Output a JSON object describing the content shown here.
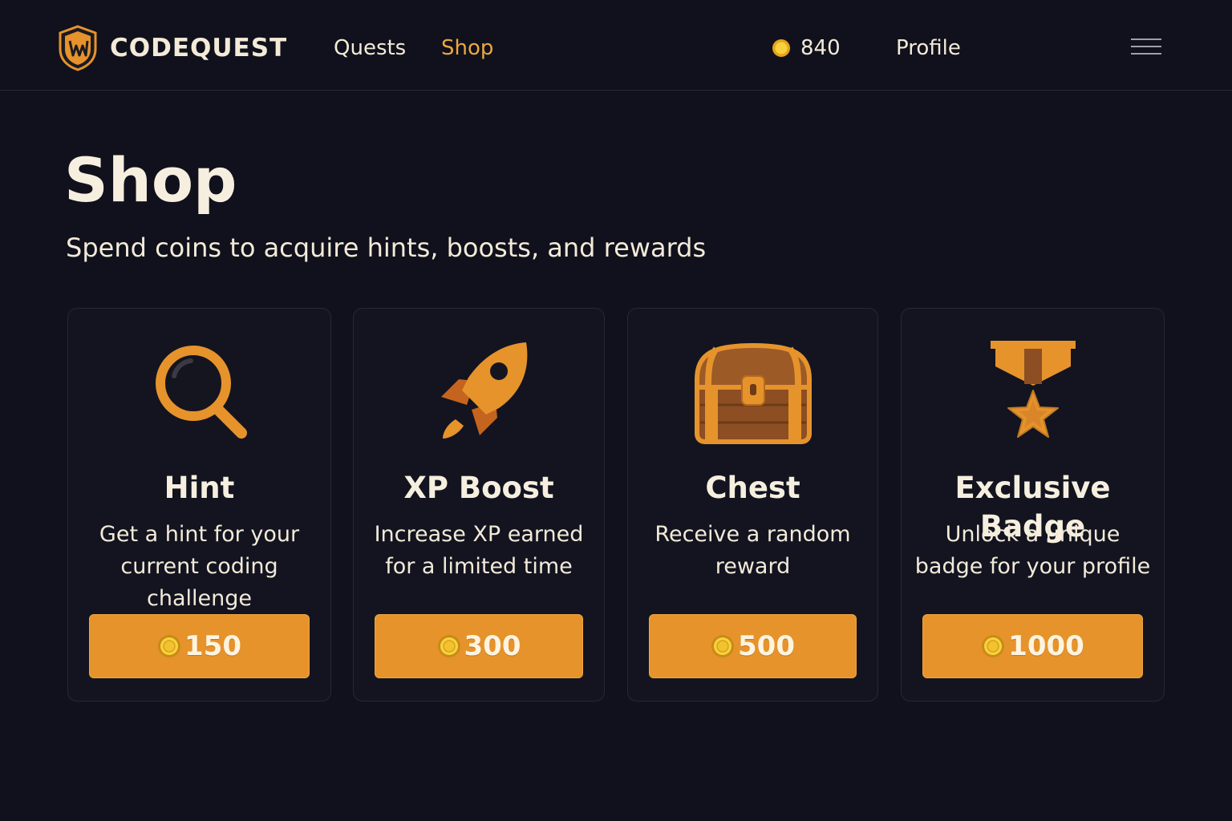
{
  "app": {
    "brand": "CODEQUEST",
    "nav": {
      "quests_label": "Quests",
      "shop_label": "Shop",
      "profile_label": "Profile",
      "active": "Shop"
    },
    "coin_balance": "840"
  },
  "page": {
    "title": "Shop",
    "subtitle": "Spend coins to acquire hints, boosts, and rewards"
  },
  "items": [
    {
      "icon": "magnifying-glass-icon",
      "title": "Hint",
      "desc_line1": "Get a hint for your",
      "desc_line2": "current coding challenge",
      "price": "150"
    },
    {
      "icon": "rocket-icon",
      "title": "XP Boost",
      "desc_line1": "Increase XP earned",
      "desc_line2": "for a limited time",
      "price": "300"
    },
    {
      "icon": "treasure-chest-icon",
      "title": "Chest",
      "desc_line1": "Receive a random",
      "desc_line2": "reward",
      "price": "500"
    },
    {
      "icon": "medal-badge-icon",
      "title": "Exclusive Badge",
      "desc_line1": "Unlock a unique",
      "desc_line2": "badge for your profile",
      "price": "1000"
    }
  ],
  "colors": {
    "background": "#10111c",
    "accent": "#e6932c",
    "active_nav": "#eca83f",
    "coin": "#f2c230"
  }
}
